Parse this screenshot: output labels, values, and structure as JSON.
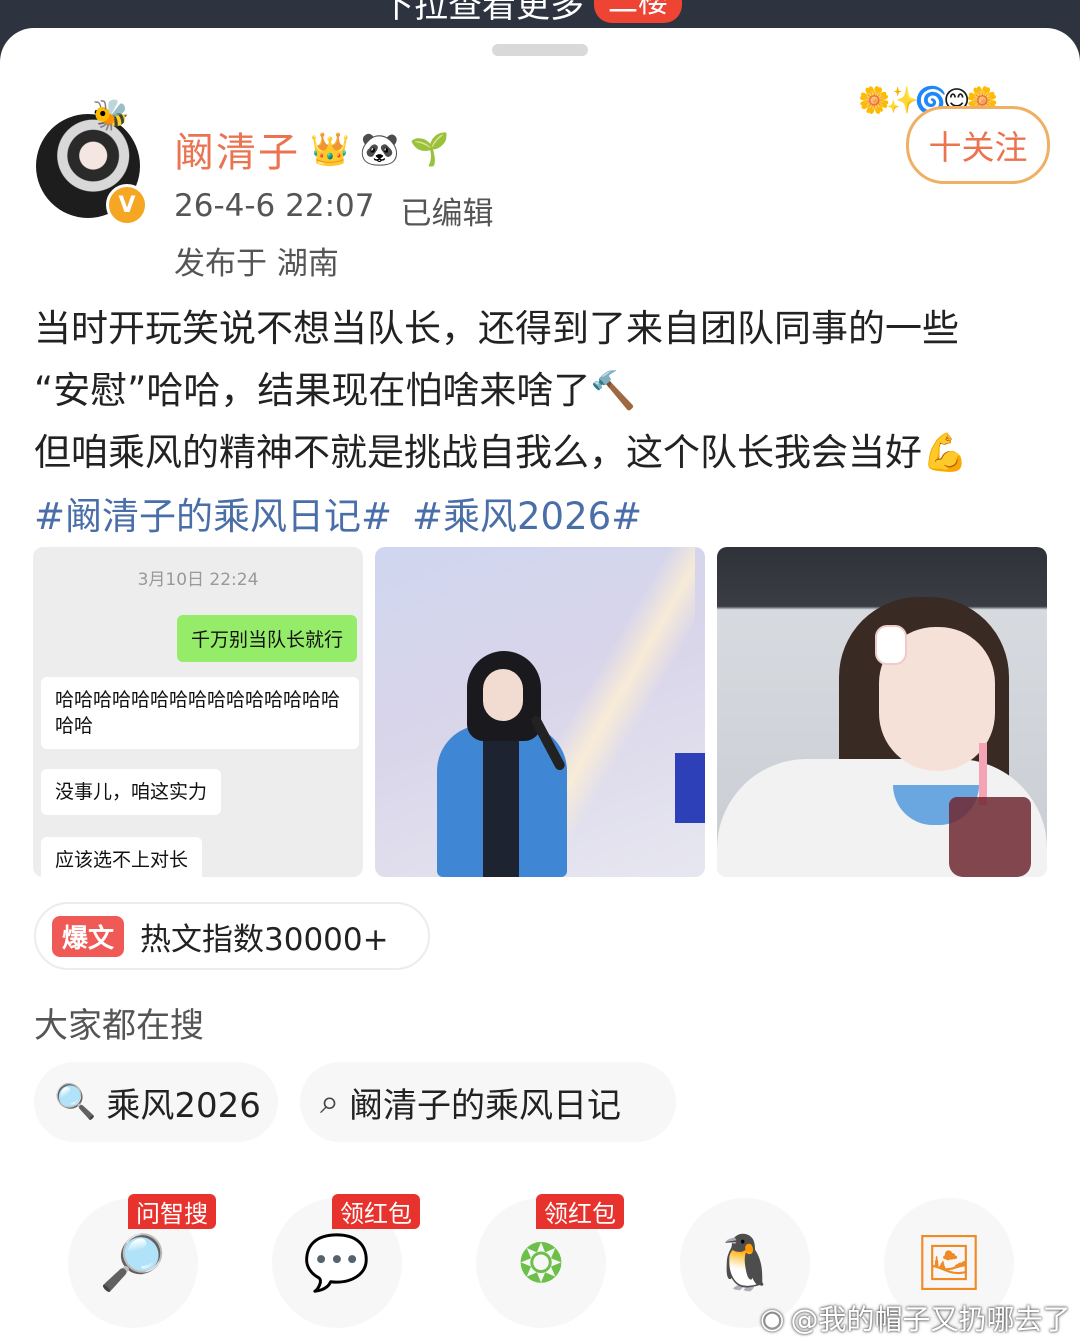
{
  "top_bar": {
    "pull_text": "下拉查看更多",
    "badge": "二楼"
  },
  "post": {
    "author": {
      "name": "阚清子",
      "badges": [
        "👑",
        "🐼",
        "🌱"
      ],
      "verified_mark": "V",
      "avatar_deco": "🐝"
    },
    "time": "26-4-6 22:07",
    "edited": "已编辑",
    "location": "发布于 湖南",
    "follow_label": "十关注",
    "follow_deco": "🌼✨🌀😊🌼",
    "text_lines": [
      "当时开玩笑说不想当队长，还得到了来自团队同事的一些",
      "“安慰”哈哈，结果现在怕啥来啥了🔨",
      "但咱乘风的精神不就是挑战自我么，这个队长我会当好💪"
    ],
    "hashtags": [
      "#阚清子的乘风日记#",
      "#乘风2026#"
    ],
    "chat_image": {
      "time": "3月10日 22:24",
      "sent": "千万别当队长就行",
      "replies": [
        "哈哈哈哈哈哈哈哈哈哈哈哈哈哈哈哈哈",
        "没事儿，咱这实力",
        "应该选不上对长"
      ]
    },
    "hot": {
      "badge": "爆文",
      "text": "热文指数30000+"
    }
  },
  "search": {
    "heading": "大家都在搜",
    "chips": [
      {
        "icon": "hot-search-icon",
        "label": "乘风2026"
      },
      {
        "icon": "search-icon",
        "label": "阚清子的乘风日记"
      }
    ]
  },
  "share": {
    "items": [
      {
        "icon": "ai-search-icon",
        "tag": "问智搜"
      },
      {
        "icon": "wechat-icon",
        "tag": "领红包"
      },
      {
        "icon": "moments-icon",
        "tag": "领红包"
      },
      {
        "icon": "qq-icon",
        "tag": ""
      },
      {
        "icon": "save-image-icon",
        "tag": ""
      }
    ]
  },
  "watermark": "@我的帽子又扔哪去了",
  "colors": {
    "username": "#eb7350",
    "hashtag": "#4a6ea8",
    "follow_border": "#f0b064",
    "hot_badge": "#f05a56"
  }
}
